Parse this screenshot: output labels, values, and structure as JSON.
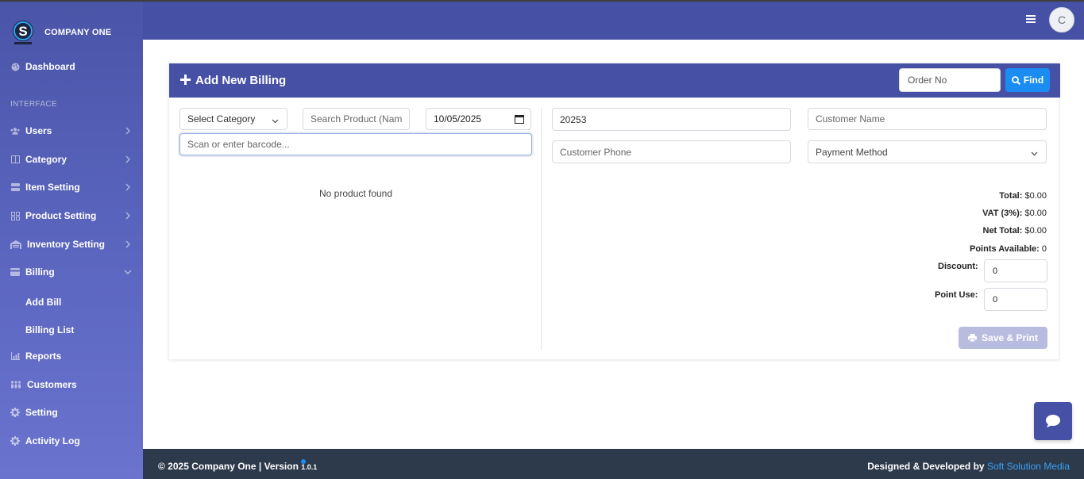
{
  "brand": {
    "name": "COMPANY ONE",
    "logo_letter": "S"
  },
  "sidebar": {
    "section_label": "INTERFACE",
    "items": [
      {
        "label": "Dashboard",
        "icon": "palette-icon"
      },
      {
        "label": "Users",
        "icon": "users-icon"
      },
      {
        "label": "Category",
        "icon": "columns-icon"
      },
      {
        "label": "Item Setting",
        "icon": "server-icon"
      },
      {
        "label": "Product Setting",
        "icon": "grid-icon"
      },
      {
        "label": "Inventory Setting",
        "icon": "warehouse-icon"
      },
      {
        "label": "Billing",
        "icon": "card-icon"
      },
      {
        "label": "Reports",
        "icon": "chart-icon"
      },
      {
        "label": "Customers",
        "icon": "people-icon"
      },
      {
        "label": "Setting",
        "icon": "gear-icon"
      },
      {
        "label": "Activity Log",
        "icon": "gear-icon"
      }
    ],
    "billing_sub": [
      "Add Bill",
      "Billing List"
    ]
  },
  "topbar": {
    "avatar_letter": "C"
  },
  "billing": {
    "title": "Add New Billing",
    "order_placeholder": "Order No",
    "find_label": "Find",
    "category_select": "Select Category",
    "search_placeholder": "Search Product (Name/",
    "date_value": "10/05/2025",
    "barcode_placeholder": "Scan or enter barcode...",
    "empty_text": "No product found",
    "invoice_no": "20253",
    "customer_name_placeholder": "Customer Name",
    "customer_phone_placeholder": "Customer Phone",
    "payment_method": "Payment Method",
    "total_label": "Total:",
    "total_value": "$0.00",
    "vat_label": "VAT (3%):",
    "vat_value": "$0.00",
    "net_label": "Net Total:",
    "net_value": "$0.00",
    "points_label": "Points Available:",
    "points_value": "0",
    "discount_label": "Discount:",
    "discount_value": "0",
    "point_use_label": "Point Use:",
    "point_use_value": "0",
    "save_label": "Save & Print"
  },
  "footer": {
    "left": "© 2025 Company One | Version",
    "version": "1.0.1",
    "right_prefix": "Designed & Developed by",
    "right_link": "Soft Solution Media"
  },
  "colors": {
    "primary": "#4651a5",
    "accent": "#1a8cf2",
    "footer": "#2d3a4b"
  }
}
